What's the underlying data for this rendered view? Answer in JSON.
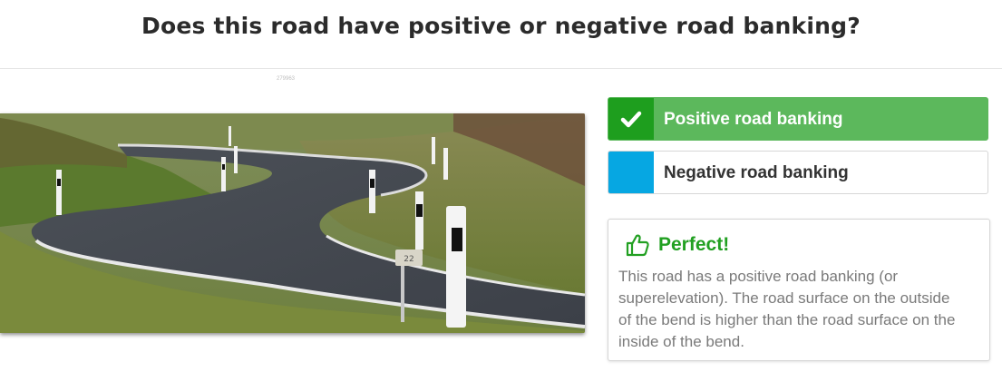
{
  "question": {
    "title": "Does this road have positive or negative road banking?"
  },
  "image": {
    "caption": "279963",
    "alt": "Winding road with reflector posts",
    "post_sign_text": "22"
  },
  "options": [
    {
      "label": "Positive road banking",
      "state": "correct-selected",
      "marker_color": "#1e9e1e",
      "background": "#5cb85c",
      "icon": "check-icon"
    },
    {
      "label": "Negative road banking",
      "state": "unselected",
      "marker_color": "#06a7e2",
      "background": "#ffffff"
    }
  ],
  "feedback": {
    "title": "Perfect!",
    "icon": "thumbs-up-icon",
    "color": "#22a022",
    "text": "This road has a positive road banking (or superelevation). The road surface on the outside of the bend is higher than the road surface on the inside of the bend."
  }
}
